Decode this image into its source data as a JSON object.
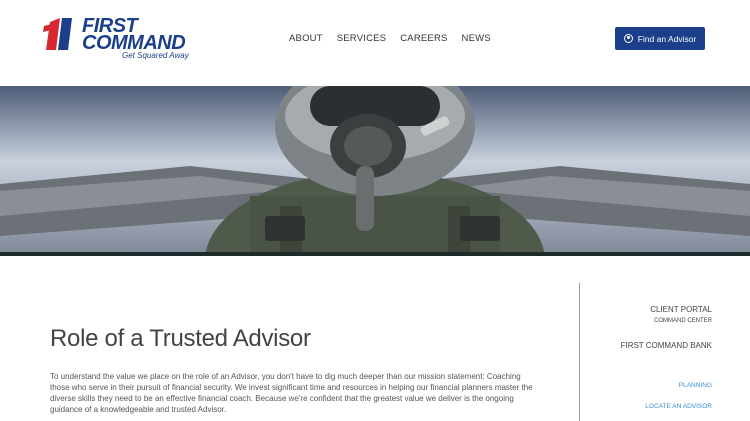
{
  "brand": {
    "logo_first": "FIRST",
    "logo_command": "COMMAND",
    "tagline": "Get Squared Away",
    "colors": {
      "primary": "#1b3f8a",
      "accent": "#d7282f"
    }
  },
  "nav": {
    "items": [
      "ABOUT",
      "SERVICES",
      "CAREERS",
      "NEWS"
    ]
  },
  "cta": {
    "label": "Find an Advisor",
    "icon": "user-circle-icon"
  },
  "hero": {
    "alt": ""
  },
  "main": {
    "title": "Role of a Trusted Advisor",
    "body": "To understand the value we place on the role of an Advisor, you don't have to dig much deeper than our mission statement: Coaching those who serve in their pursuit of financial security. We invest significant time and resources in helping our financial planners master the diverse skills they need to be an effective financial coach. Because we're confident that the greatest value we deliver is the ongoing guidance of a knowledgeable and trusted Advisor."
  },
  "sidebar": {
    "client_portal": "CLIENT PORTAL",
    "command_center": "COMMAND CENTER",
    "bank": "FIRST COMMAND BANK",
    "planning": "PLANNING",
    "locate": "LOCATE AN ADVISOR"
  }
}
